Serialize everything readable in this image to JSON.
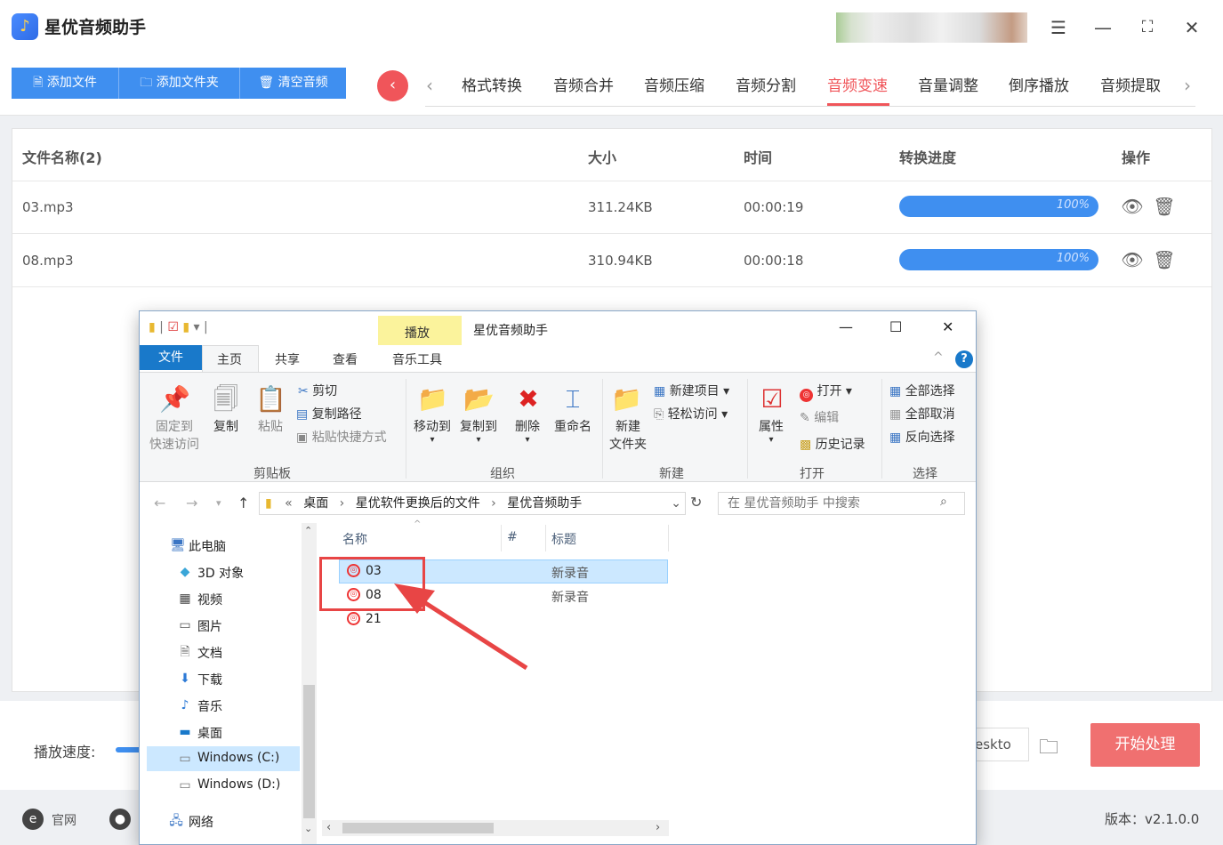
{
  "app": {
    "title": "星优音频助手"
  },
  "toolbar": {
    "add_file": "添加文件",
    "add_folder": "添加文件夹",
    "clear": "清空音频"
  },
  "tabs": [
    "格式转换",
    "音频合并",
    "音频压缩",
    "音频分割",
    "音频变速",
    "音量调整",
    "倒序播放",
    "音频提取"
  ],
  "active_tab": "音频变速",
  "table": {
    "headers": [
      "文件名称(2)",
      "大小",
      "时间",
      "转换进度",
      "操作"
    ],
    "rows": [
      {
        "name": "03.mp3",
        "size": "311.24KB",
        "time": "00:00:19",
        "progress": "100%"
      },
      {
        "name": "08.mp3",
        "size": "310.94KB",
        "time": "00:00:18",
        "progress": "100%"
      }
    ]
  },
  "bottom": {
    "speed_label": "播放速度:",
    "output_path": "eskto",
    "start_button": "开始处理"
  },
  "footer": {
    "site": "官网",
    "version": "版本：v2.1.0.0"
  },
  "explorer": {
    "title": "星优音频助手",
    "context_tab": "播放",
    "tabs": {
      "file": "文件",
      "home": "主页",
      "share": "共享",
      "view": "查看",
      "music": "音乐工具"
    },
    "ribbon": {
      "pin": [
        "固定到",
        "快速访问"
      ],
      "copy": "复制",
      "paste": "粘贴",
      "cut": "剪切",
      "copy_path": "复制路径",
      "paste_shortcut": "粘贴快捷方式",
      "clipboard": "剪贴板",
      "move_to": "移动到",
      "copy_to": "复制到",
      "delete": "删除",
      "rename": "重命名",
      "organize": "组织",
      "new_folder": [
        "新建",
        "文件夹"
      ],
      "new_item": "新建项目",
      "easy_access": "轻松访问",
      "new": "新建",
      "properties": "属性",
      "open": "打开",
      "edit": "编辑",
      "history": "历史记录",
      "open_group": "打开",
      "select_all": "全部选择",
      "select_none": "全部取消",
      "invert": "反向选择",
      "select": "选择"
    },
    "address": {
      "root": "桌面",
      "p1": "星优软件更换后的文件",
      "p2": "星优音频助手"
    },
    "search_placeholder": "在 星优音频助手 中搜索",
    "nav": [
      {
        "name": "此电脑",
        "icon": "pc-icon"
      },
      {
        "name": "3D 对象",
        "icon": "3d-objects-icon"
      },
      {
        "name": "视频",
        "icon": "video-icon"
      },
      {
        "name": "图片",
        "icon": "pictures-icon"
      },
      {
        "name": "文档",
        "icon": "documents-icon"
      },
      {
        "name": "下载",
        "icon": "downloads-icon"
      },
      {
        "name": "音乐",
        "icon": "music-icon"
      },
      {
        "name": "桌面",
        "icon": "desktop-icon"
      },
      {
        "name": "Windows (C:)",
        "icon": "drive-c-icon"
      },
      {
        "name": "Windows (D:)",
        "icon": "drive-d-icon"
      },
      {
        "name": "网络",
        "icon": "network-icon"
      }
    ],
    "columns": {
      "name": "名称",
      "num": "#",
      "title": "标题"
    },
    "files": [
      {
        "name": "03",
        "title": "新录音"
      },
      {
        "name": "08",
        "title": "新录音"
      },
      {
        "name": "21",
        "title": ""
      }
    ]
  },
  "colors": {
    "accent": "#3f8ff0",
    "active": "#f0555a",
    "start": "#f07070",
    "highlight": "#e84545"
  }
}
